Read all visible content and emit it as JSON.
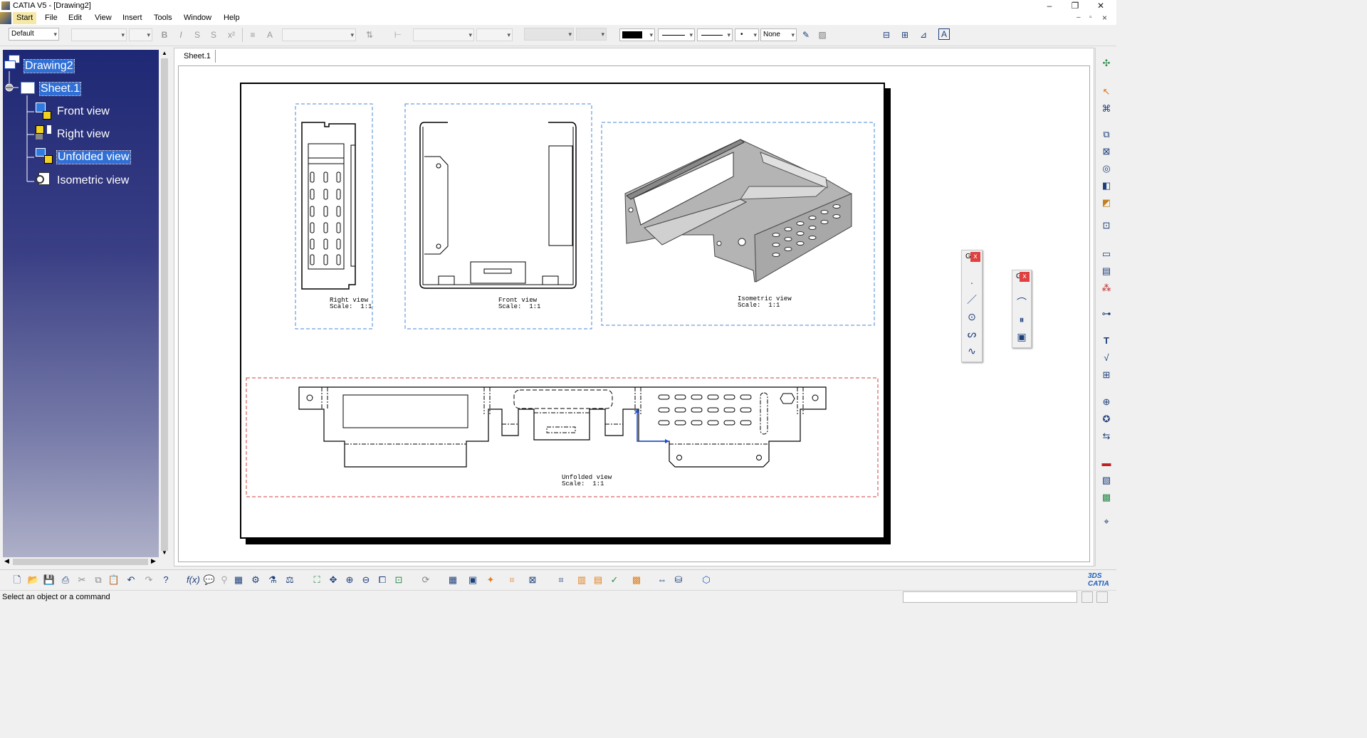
{
  "window": {
    "title": "CATIA V5 - [Drawing2]",
    "minimize": "–",
    "restore": "❐",
    "close": "✕",
    "child_minimize": "‒",
    "child_restore": "▫",
    "child_close": "×"
  },
  "menu": [
    "Start",
    "File",
    "Edit",
    "View",
    "Insert",
    "Tools",
    "Window",
    "Help"
  ],
  "toolbar": {
    "style_combo": "Default",
    "fill_color": "#000000",
    "pattern_combo": "None"
  },
  "tree": {
    "root": "Drawing2",
    "sheet": "Sheet.1",
    "views": [
      "Front view",
      "Right view",
      "Unfolded view",
      "Isometric view"
    ]
  },
  "sheet_tab": "Sheet.1",
  "views": {
    "right": {
      "name": "Right view",
      "scale": "Scale:  1:1"
    },
    "front": {
      "name": "Front view",
      "scale": "Scale:  1:1"
    },
    "iso": {
      "name": "Isometric view",
      "scale": "Scale:  1:1"
    },
    "unfolded": {
      "name": "Unfolded view",
      "scale": "Scale:  1:1"
    }
  },
  "palettes": {
    "geometry": {
      "title": "G",
      "close": "x"
    },
    "dress": {
      "title": "G",
      "close": "x"
    }
  },
  "status": {
    "message": "Select an object or a command"
  },
  "colors": {
    "tree_top": "#1e2874",
    "selection": "#2f6fd6",
    "view_frame_blue": "#4a8ad6",
    "view_frame_red": "#d04040"
  }
}
